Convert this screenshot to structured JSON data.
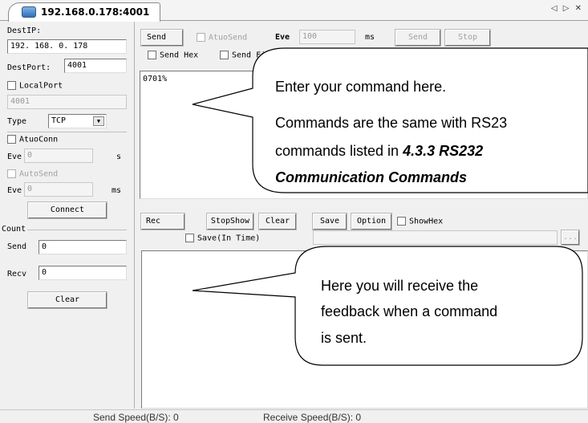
{
  "tab": {
    "title": "192.168.0.178:4001",
    "nav": "◁ ▷ ✕"
  },
  "left": {
    "dest_ip_label": "DestIP:",
    "dest_ip_value": "192. 168. 0. 178",
    "dest_port_label": "DestPort:",
    "dest_port_value": "4001",
    "local_port_label": "LocalPort",
    "local_port_value": "4001",
    "type_label": "Type",
    "type_value": "TCP",
    "auto_conn_label": "AtuoConn",
    "eve1_label": "Eve",
    "eve1_value": "0",
    "eve1_unit": "s",
    "auto_send_label": "AutoSend",
    "eve2_label": "Eve",
    "eve2_value": "0",
    "eve2_unit": "ms",
    "connect_label": "Connect",
    "count_label": "Count",
    "send_label": "Send",
    "send_value": "0",
    "recv_label": "Recv",
    "recv_value": "0",
    "clear_label": "Clear"
  },
  "send_bar": {
    "send_label": "Send",
    "auto_send_label": "AtuoSend",
    "eve_label": "Eve",
    "eve_value": "100",
    "ms_label": "ms",
    "send_btn": "Send",
    "stop_btn": "Stop",
    "send_hex_label": "Send Hex",
    "send_file_label": "Send Fil"
  },
  "send_text": "0701%",
  "rec_bar": {
    "rec_label": "Rec",
    "stop_show": "StopShow",
    "clear": "Clear",
    "save": "Save",
    "option": "Option",
    "show_hex": "ShowHex",
    "save_in_time": "Save(In Time)",
    "browse": "..."
  },
  "callout_send": {
    "line1": "Enter your command here.",
    "line2": "Commands are the same with RS23",
    "line3_prefix": "commands listed in ",
    "line3_bold": "4.3.3 RS232",
    "line4_bold": "Communication Commands"
  },
  "callout_recv": {
    "line1": "Here you will receive the",
    "line2": "feedback when a command",
    "line3": "is sent."
  },
  "status": {
    "send_speed": "Send Speed(B/S): 0",
    "recv_speed": "Receive Speed(B/S): 0"
  }
}
